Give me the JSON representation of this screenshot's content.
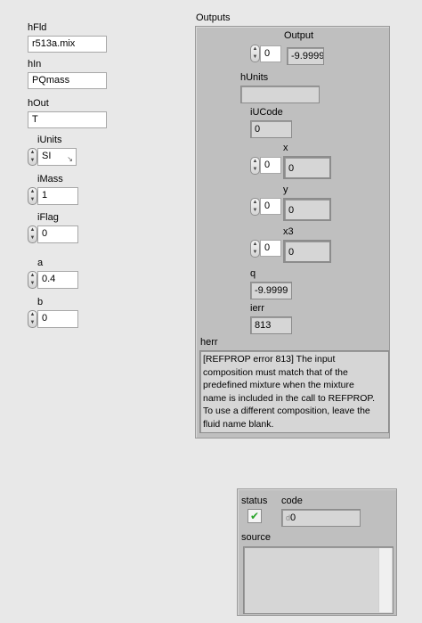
{
  "inputs": {
    "hFld": {
      "label": "hFld",
      "value": "r513a.mix"
    },
    "hIn": {
      "label": "hIn",
      "value": "PQmass"
    },
    "hOut": {
      "label": "hOut",
      "value": "T"
    },
    "iUnits": {
      "label": "iUnits",
      "value": "SI"
    },
    "iMass": {
      "label": "iMass",
      "value": "1"
    },
    "iFlag": {
      "label": "iFlag",
      "value": "0"
    },
    "a": {
      "label": "a",
      "value": "0.4"
    },
    "b": {
      "label": "b",
      "value": "0"
    }
  },
  "outputs": {
    "title": "Outputs",
    "output": {
      "label": "Output",
      "index": "0",
      "value": "-9.9999"
    },
    "hUnits": {
      "label": "hUnits",
      "value": ""
    },
    "iUCode": {
      "label": "iUCode",
      "value": "0"
    },
    "x": {
      "label": "x",
      "index": "0",
      "value": "0"
    },
    "y": {
      "label": "y",
      "index": "0",
      "value": "0"
    },
    "x3": {
      "label": "x3",
      "index": "0",
      "value": "0"
    },
    "q": {
      "label": "q",
      "value": "-9.9999"
    },
    "ierr": {
      "label": "ierr",
      "value": "813"
    },
    "herr": {
      "label": "herr",
      "lines": [
        "[REFPROP error 813] The input",
        "composition must match that of the",
        "predefined mixture when the mixture",
        "name is included in the call to REFPROP.",
        "To use a different composition, leave the",
        "fluid name blank."
      ]
    }
  },
  "error_cluster": {
    "status_label": "status",
    "code_label": "code",
    "code_value": "0",
    "code_prefix": "d",
    "source_label": "source",
    "source_value": "",
    "status_ok_color": "#2aa52a"
  }
}
